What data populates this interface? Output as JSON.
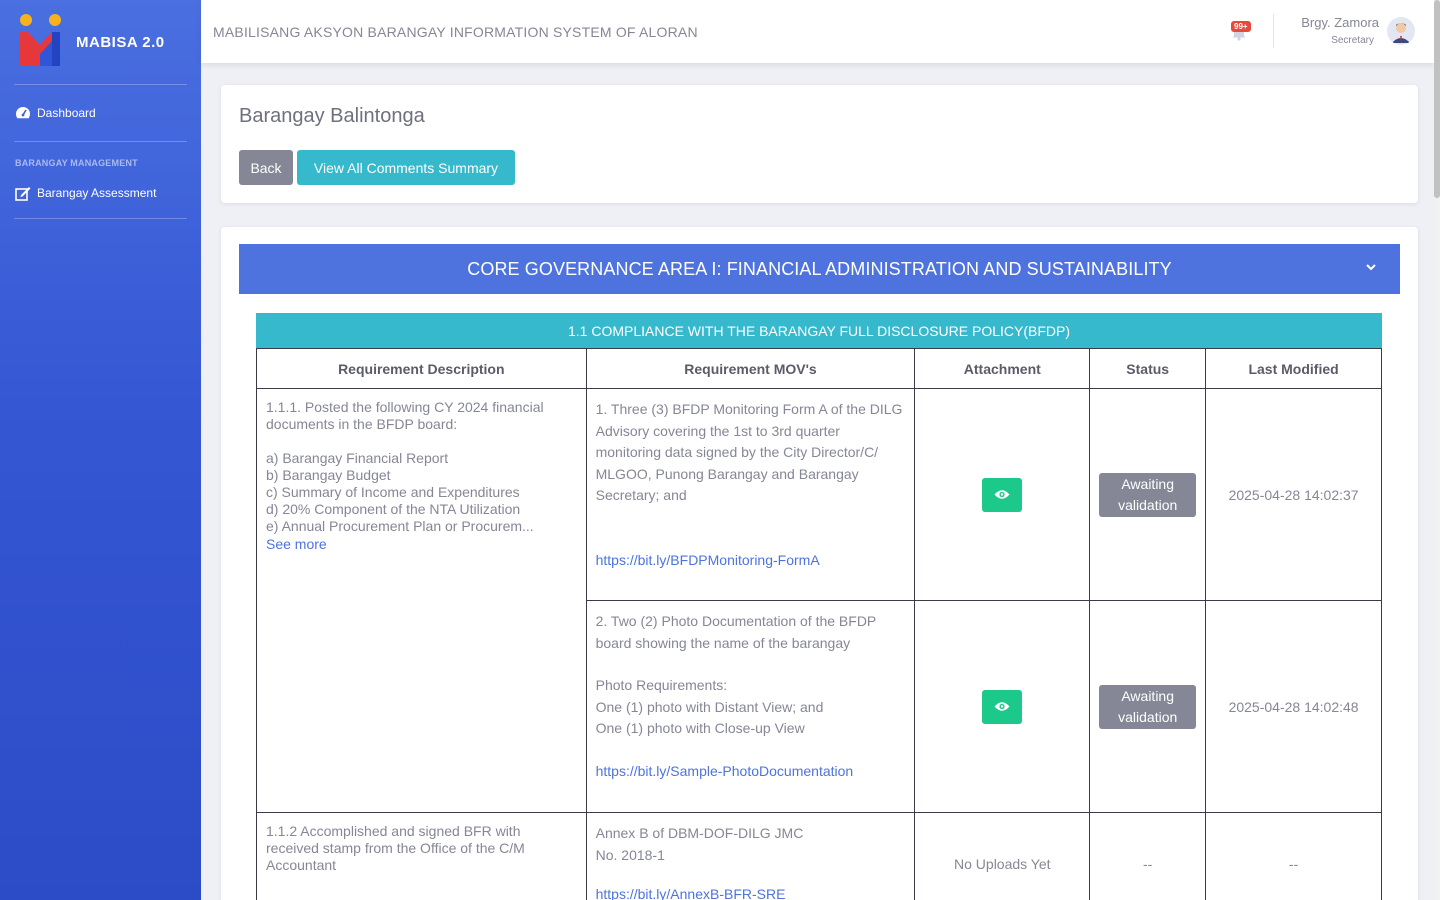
{
  "brand": {
    "name": "MABISA 2.0"
  },
  "sidebar": {
    "items": [
      {
        "label": "Dashboard"
      }
    ],
    "heading": "BARANGAY MANAGEMENT",
    "sub_items": [
      {
        "label": "Barangay Assessment"
      }
    ]
  },
  "topbar": {
    "system_title": "MABILISANG AKSYON BARANGAY INFORMATION SYSTEM OF ALORAN",
    "notif_count": "99+",
    "user_name": "Brgy. Zamora",
    "user_role": "Secretary"
  },
  "page": {
    "title": "Barangay Balintonga",
    "back_label": "Back",
    "view_comments_label": "View All Comments Summary"
  },
  "area": {
    "title": "CORE GOVERNANCE AREA I: FINANCIAL ADMINISTRATION AND SUSTAINABILITY",
    "indicator": "1.1 COMPLIANCE WITH THE BARANGAY FULL DISCLOSURE POLICY(BFDP)"
  },
  "table": {
    "headers": [
      "Requirement Description",
      "Requirement MOV's",
      "Attachment",
      "Status",
      "Last Modified"
    ],
    "req1": {
      "desc_intro": "1.1.1. Posted the following CY 2024 financial documents in the BFDP board:",
      "desc_items": [
        "a) Barangay Financial Report",
        "b) Barangay Budget",
        "c) Summary of Income and Expenditures",
        "d) 20% Component of the NTA Utilization",
        "e) Annual Procurement Plan or Procurem..."
      ],
      "see_more": "See more",
      "mov1_text": "1. Three (3) BFDP Monitoring Form A of the DILG Advisory covering the 1st to 3rd quarter monitoring data signed by the City Director/C/ MLGOO, Punong Barangay and Barangay Secretary; and",
      "mov1_link": "https://bit.ly/BFDPMonitoring-FormA",
      "mov1_status": "Awaiting validation",
      "mov1_modified": "2025-04-28 14:02:37",
      "mov2_text": "2. Two (2) Photo Documentation of the BFDP board showing the name of the barangay",
      "mov2_photo_req": "Photo Requirements:",
      "mov2_line1": "One (1) photo with Distant View; and",
      "mov2_line2": "One (1) photo with Close-up View",
      "mov2_link": "https://bit.ly/Sample-PhotoDocumentation",
      "mov2_status": "Awaiting validation",
      "mov2_modified": "2025-04-28 14:02:48"
    },
    "req2": {
      "desc": "1.1.2 Accomplished and signed BFR with received stamp from the Office of the C/M Accountant",
      "mov_line1": "Annex B of DBM-DOF-DILG JMC",
      "mov_line2": "No. 2018-1",
      "mov_link": "https://bit.ly/AnnexB-BFR-SRE",
      "attachment": "No Uploads Yet",
      "status": "--",
      "modified": "--"
    }
  },
  "colors": {
    "primary": "#4e73df",
    "info": "#36b9cc",
    "success": "#1cc88a",
    "secondary": "#858796",
    "danger": "#e74a3b",
    "brand_yellow": "#f9b21d",
    "brand_red": "#e8373a"
  },
  "icons": {
    "dashboard": "tachometer-icon",
    "assessment": "edit-icon",
    "notifications": "bell-icon",
    "view": "eye-icon",
    "collapse": "chevron-down-icon"
  }
}
